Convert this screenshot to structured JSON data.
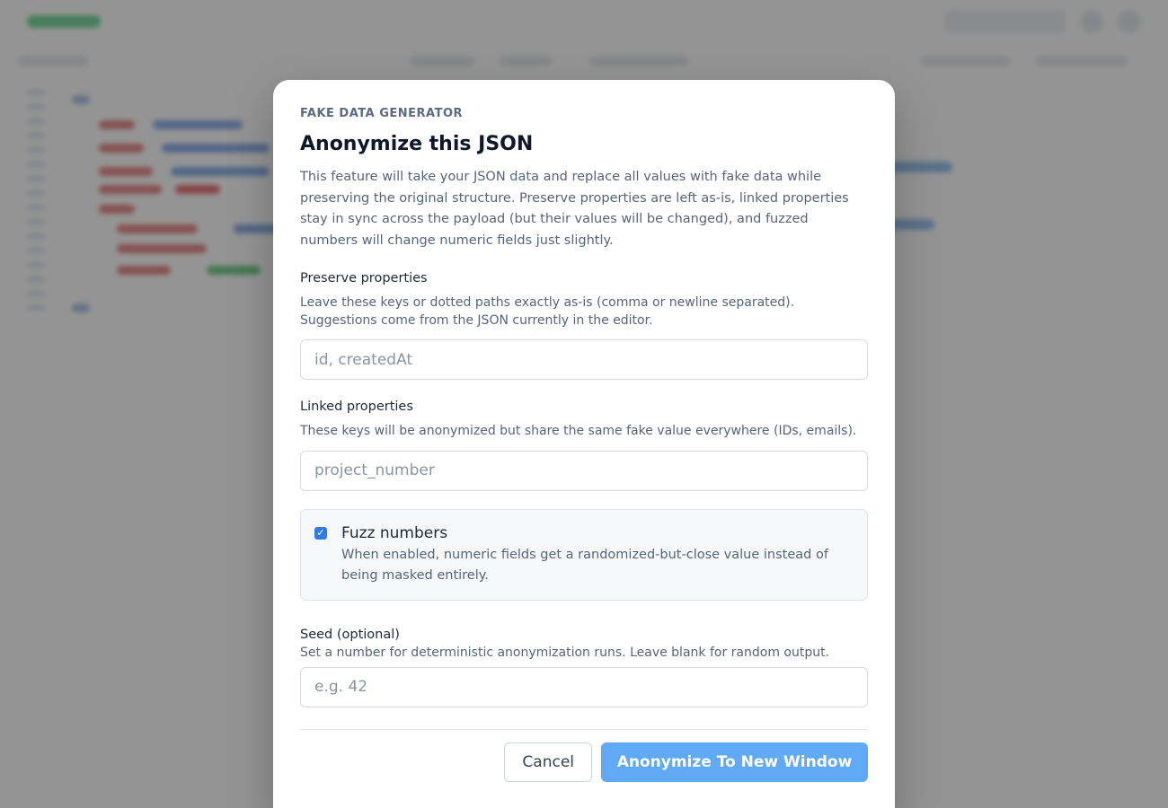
{
  "modal": {
    "eyebrow": "FAKE DATA GENERATOR",
    "title": "Anonymize this JSON",
    "description": "This feature will take your JSON data and replace all values with fake data while preserving the original structure. Preserve properties are left as-is, linked properties stay in sync across the payload (but their values will be changed), and fuzzed numbers will change numeric fields just slightly.",
    "preserve": {
      "label": "Preserve properties",
      "help": "Leave these keys or dotted paths exactly as-is (comma or newline separated). Suggestions come from the JSON currently in the editor.",
      "placeholder": "id, createdAt",
      "value": ""
    },
    "linked": {
      "label": "Linked properties",
      "help": "These keys will be anonymized but share the same fake value everywhere (IDs, emails).",
      "placeholder": "project_number",
      "value": ""
    },
    "fuzz": {
      "label": "Fuzz numbers",
      "help": "When enabled, numeric fields get a randomized-but-close value instead of being masked entirely.",
      "checked": true
    },
    "seed": {
      "label": "Seed (optional)",
      "help": "Set a number for deterministic anonymization runs. Leave blank for random output.",
      "placeholder": "e.g. 42",
      "value": ""
    },
    "buttons": {
      "cancel": "Cancel",
      "submit": "Anonymize To New Window"
    }
  },
  "colors": {
    "primary_button": "#60a9f5",
    "checkbox": "#2f7de1",
    "overlay": "rgba(60,60,60,0.55)"
  },
  "icons": {
    "checkbox_mark": "check-icon"
  }
}
